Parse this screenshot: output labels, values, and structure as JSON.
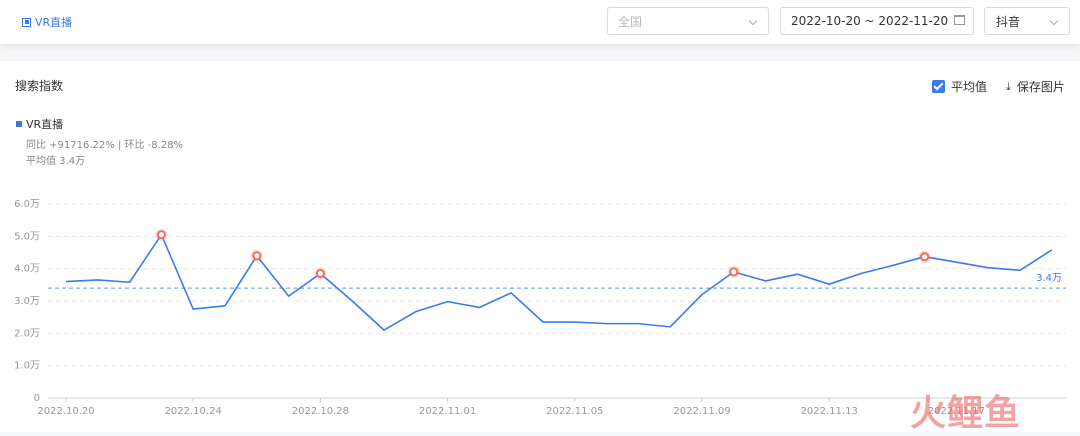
{
  "tag": {
    "label": "VR直播"
  },
  "filters": {
    "region": "全国",
    "date_range": "2022-10-20 ~ 2022-11-20",
    "platform": "抖音"
  },
  "panel": {
    "title": "搜索指数",
    "avg_toggle_label": "平均值",
    "save_label": "保存图片",
    "legend": "VR直播",
    "yoy_text": "同比 +91716.22% | 环比 -8.28%",
    "avg_text": "平均值 3.4万"
  },
  "watermark": "火鲤鱼",
  "chart_data": {
    "type": "line",
    "x_ticks": [
      "2022.10.20",
      "2022.10.24",
      "2022.10.28",
      "2022.11.01",
      "2022.11.05",
      "2022.11.09",
      "2022.11.13",
      "2022.11.17"
    ],
    "y_ticks": [
      "0",
      "1.0万",
      "2.0万",
      "3.0万",
      "4.0万",
      "5.0万",
      "6.0万"
    ],
    "ylim": [
      0,
      60000
    ],
    "series": [
      {
        "name": "VR直播",
        "color": "#3b7be8",
        "x": [
          "2022.10.20",
          "2022.10.21",
          "2022.10.22",
          "2022.10.23",
          "2022.10.24",
          "2022.10.25",
          "2022.10.26",
          "2022.10.27",
          "2022.10.28",
          "2022.10.29",
          "2022.10.30",
          "2022.10.31",
          "2022.11.01",
          "2022.11.02",
          "2022.11.03",
          "2022.11.04",
          "2022.11.05",
          "2022.11.06",
          "2022.11.07",
          "2022.11.08",
          "2022.11.09",
          "2022.11.10",
          "2022.11.11",
          "2022.11.12",
          "2022.11.13",
          "2022.11.14",
          "2022.11.15",
          "2022.11.16",
          "2022.11.17",
          "2022.11.18",
          "2022.11.19",
          "2022.11.20"
        ],
        "values": [
          36000,
          36500,
          35800,
          50500,
          27500,
          28500,
          44000,
          31500,
          38500,
          30000,
          21000,
          26700,
          29800,
          28000,
          32500,
          23500,
          23500,
          23000,
          23000,
          22000,
          32000,
          39000,
          36200,
          38300,
          35200,
          38500,
          41000,
          43700,
          42000,
          40300,
          39500,
          45800
        ]
      }
    ],
    "highlight_indices": [
      3,
      6,
      8,
      21,
      27
    ],
    "average": {
      "value": 34000,
      "label": "3.4万"
    }
  }
}
